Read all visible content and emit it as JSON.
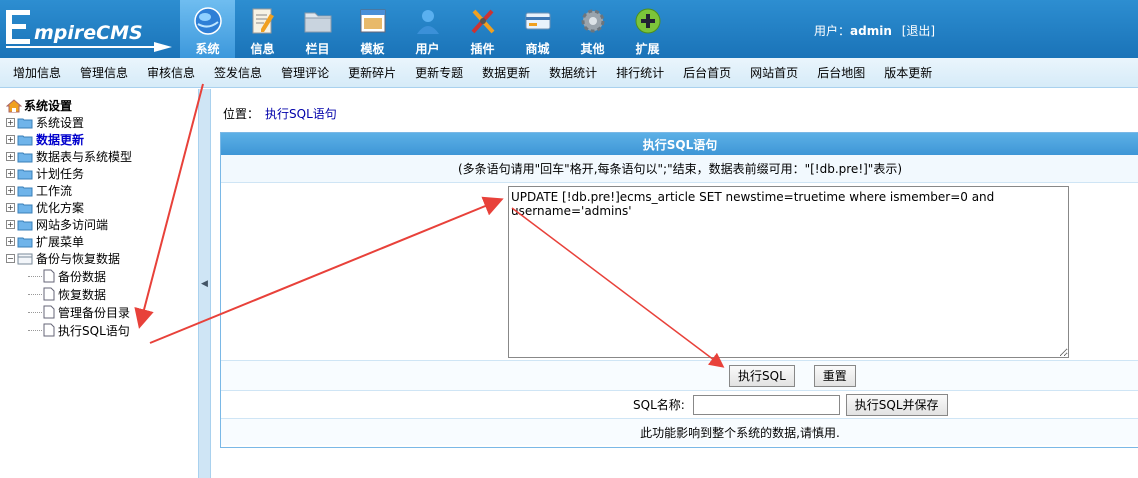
{
  "logo": {
    "text_big": "E",
    "text_rest": "mpireCMS"
  },
  "nav": [
    {
      "label": "系统",
      "icon": "globe-icon",
      "active": true
    },
    {
      "label": "信息",
      "icon": "document-edit-icon"
    },
    {
      "label": "栏目",
      "icon": "folder-icon"
    },
    {
      "label": "模板",
      "icon": "window-template-icon"
    },
    {
      "label": "用户",
      "icon": "user-icon"
    },
    {
      "label": "插件",
      "icon": "tools-icon"
    },
    {
      "label": "商城",
      "icon": "card-icon"
    },
    {
      "label": "其他",
      "icon": "gear-icon"
    },
    {
      "label": "扩展",
      "icon": "plus-circle-icon"
    }
  ],
  "user": {
    "prefix": "用户：",
    "name": "admin",
    "logout": "[退出]"
  },
  "subnav": [
    "增加信息",
    "管理信息",
    "审核信息",
    "签发信息",
    "管理评论",
    "更新碎片",
    "更新专题",
    "数据更新",
    "数据统计",
    "排行统计",
    "后台首页",
    "网站首页",
    "后台地图",
    "版本更新"
  ],
  "sidebar": {
    "root": "系统设置",
    "items": [
      {
        "label": "系统设置"
      },
      {
        "label": "数据更新",
        "highlight": true
      },
      {
        "label": "数据表与系统模型"
      },
      {
        "label": "计划任务"
      },
      {
        "label": "工作流"
      },
      {
        "label": "优化方案"
      },
      {
        "label": "网站多访问端"
      },
      {
        "label": "扩展菜单"
      },
      {
        "label": "备份与恢复数据",
        "expanded": true
      }
    ],
    "children": [
      "备份数据",
      "恢复数据",
      "管理备份目录",
      "执行SQL语句"
    ]
  },
  "breadcrumb": {
    "prefix": "位置：",
    "current": "执行SQL语句"
  },
  "panel": {
    "title": "执行SQL语句",
    "hint": "(多条语句请用\"回车\"格开,每条语句以\";\"结束，数据表前缀可用：\"[!db.pre!]\"表示)",
    "sql_value": "UPDATE [!db.pre!]ecms_article SET newstime=truetime where ismember=0 and username='admins'",
    "execute_label": "执行SQL",
    "reset_label": "重置",
    "name_label": "SQL名称:",
    "name_value": "",
    "execute_save_label": "执行SQL并保存",
    "warning": "此功能影响到整个系统的数据,请慎用."
  },
  "colors": {
    "header": "#1a73b8",
    "accent": "#3e96d6",
    "arrow": "#e8413a"
  }
}
